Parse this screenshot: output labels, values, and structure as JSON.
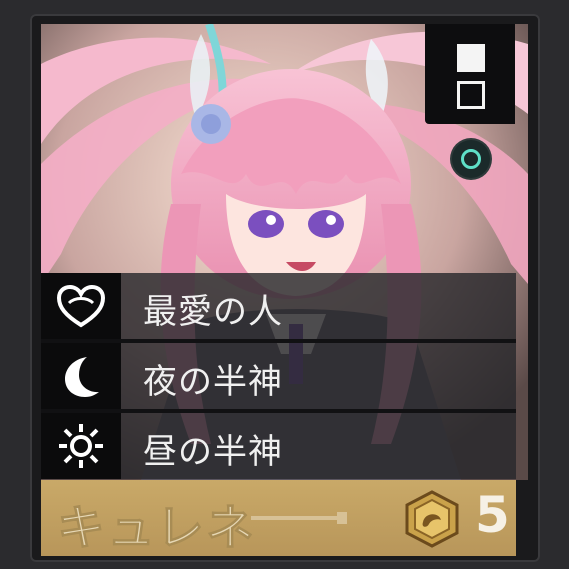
{
  "card": {
    "name": "キュレネ",
    "cost": "5",
    "traits": [
      {
        "icon": "heart-bond-icon",
        "label": "最愛の人"
      },
      {
        "icon": "crescent-moon-icon",
        "label": "夜の半神"
      },
      {
        "icon": "sun-icon",
        "label": "昼の半神"
      }
    ],
    "mode_icons": [
      "filled-square-icon",
      "outline-square-icon"
    ],
    "ring_icon": "ring-icon"
  },
  "colors": {
    "name_bar": "#c9a968",
    "ring_accent": "#5fe0c8",
    "hair": "#f2a3c0"
  }
}
